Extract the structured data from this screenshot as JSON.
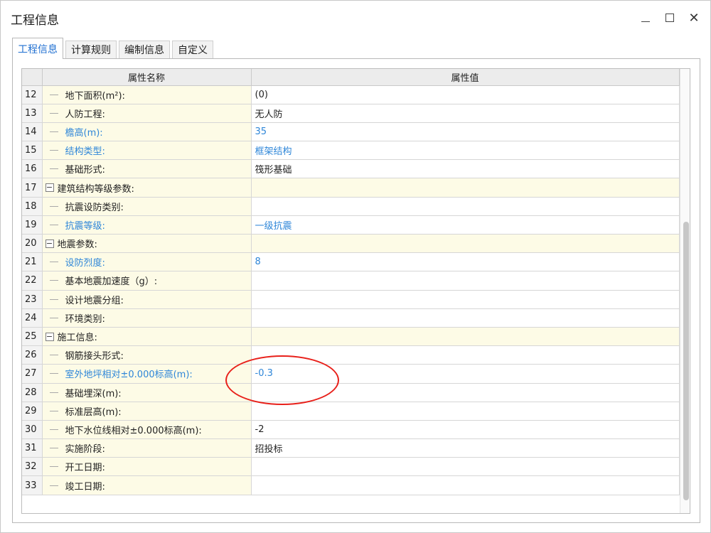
{
  "window": {
    "title": "工程信息"
  },
  "tabs": [
    {
      "label": "工程信息",
      "active": true
    },
    {
      "label": "计算规则",
      "active": false
    },
    {
      "label": "编制信息",
      "active": false
    },
    {
      "label": "自定义",
      "active": false
    }
  ],
  "table": {
    "headers": {
      "name": "属性名称",
      "value": "属性值"
    },
    "rows": [
      {
        "num": "12",
        "name": "地下面积(m²):",
        "value": "(0)",
        "blue": false,
        "group": false
      },
      {
        "num": "13",
        "name": "人防工程:",
        "value": "无人防",
        "blue": false,
        "group": false
      },
      {
        "num": "14",
        "name": "檐高(m):",
        "value": "35",
        "blue": true,
        "group": false
      },
      {
        "num": "15",
        "name": "结构类型:",
        "value": "框架结构",
        "blue": true,
        "group": false
      },
      {
        "num": "16",
        "name": "基础形式:",
        "value": "筏形基础",
        "blue": false,
        "group": false
      },
      {
        "num": "17",
        "name": "建筑结构等级参数:",
        "value": "",
        "blue": false,
        "group": true
      },
      {
        "num": "18",
        "name": "抗震设防类别:",
        "value": "",
        "blue": false,
        "group": false
      },
      {
        "num": "19",
        "name": "抗震等级:",
        "value": "一级抗震",
        "blue": true,
        "group": false
      },
      {
        "num": "20",
        "name": "地震参数:",
        "value": "",
        "blue": false,
        "group": true
      },
      {
        "num": "21",
        "name": "设防烈度:",
        "value": "8",
        "blue": true,
        "group": false
      },
      {
        "num": "22",
        "name": "基本地震加速度（g）:",
        "value": "",
        "blue": false,
        "group": false
      },
      {
        "num": "23",
        "name": "设计地震分组:",
        "value": "",
        "blue": false,
        "group": false
      },
      {
        "num": "24",
        "name": "环境类别:",
        "value": "",
        "blue": false,
        "group": false
      },
      {
        "num": "25",
        "name": "施工信息:",
        "value": "",
        "blue": false,
        "group": true
      },
      {
        "num": "26",
        "name": "钢筋接头形式:",
        "value": "",
        "blue": false,
        "group": false
      },
      {
        "num": "27",
        "name": "室外地坪相对±0.000标高(m):",
        "value": "-0.3",
        "blue": true,
        "group": false
      },
      {
        "num": "28",
        "name": "基础埋深(m):",
        "value": "",
        "blue": false,
        "group": false
      },
      {
        "num": "29",
        "name": "标准层高(m):",
        "value": "",
        "blue": false,
        "group": false
      },
      {
        "num": "30",
        "name": "地下水位线相对±0.000标高(m):",
        "value": "-2",
        "blue": false,
        "group": false
      },
      {
        "num": "31",
        "name": "实施阶段:",
        "value": "招投标",
        "blue": false,
        "group": false
      },
      {
        "num": "32",
        "name": "开工日期:",
        "value": "",
        "blue": false,
        "group": false
      },
      {
        "num": "33",
        "name": "竣工日期:",
        "value": "",
        "blue": false,
        "group": false
      }
    ]
  },
  "icons": {
    "minimize": "minimize-icon",
    "maximize": "maximize-icon",
    "close": "close-icon",
    "collapse": "collapse-minus-icon"
  },
  "colors": {
    "accent": "#1f6fd1",
    "modified_text": "#2e86d8",
    "name_bg": "#fdfbe6",
    "annotation": "#e8201a"
  },
  "glyphs": {
    "close": "✕",
    "collapse": "−"
  }
}
